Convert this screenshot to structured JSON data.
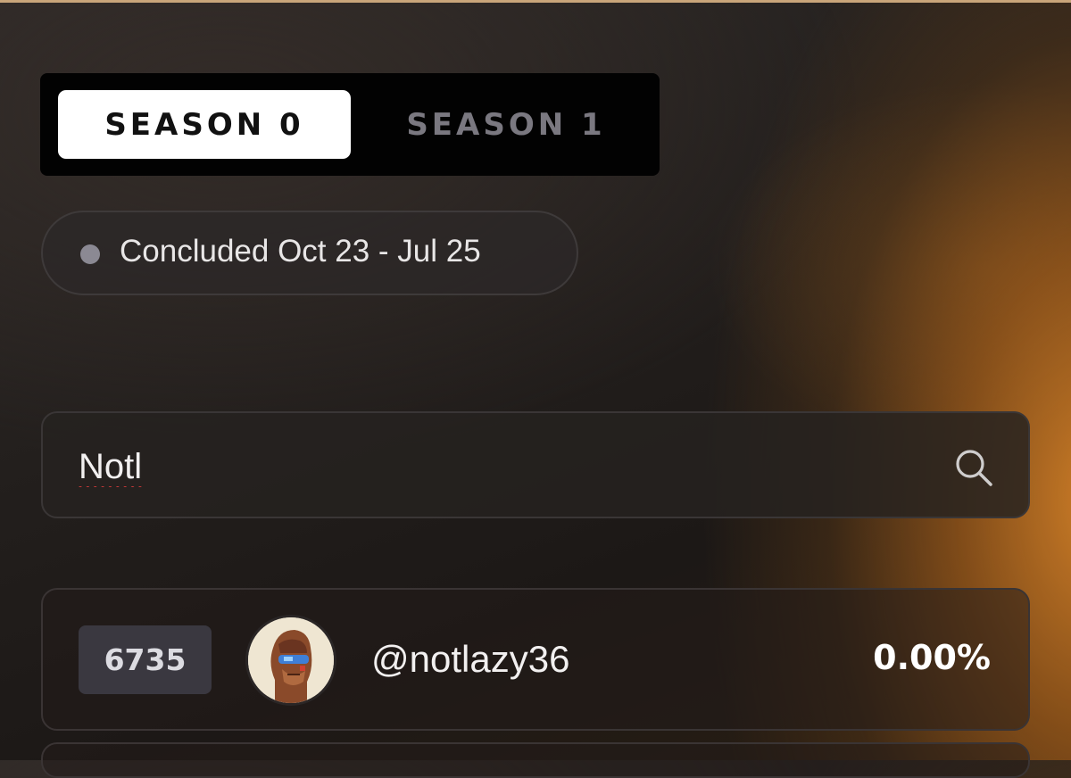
{
  "seasons": {
    "tabs": [
      {
        "label": "SEASON 0",
        "selected": true
      },
      {
        "label": "SEASON 1",
        "selected": false
      }
    ]
  },
  "status": {
    "text": "Concluded Oct 23 - Jul 25",
    "dot_color": "#8b8993"
  },
  "search": {
    "value": "Notl",
    "icon": "search-icon"
  },
  "results": [
    {
      "rank": "6735",
      "username": "@notlazy36",
      "share": "0.00%",
      "avatar": "ape-avatar"
    }
  ],
  "colors": {
    "accent_glow": "#d6822a",
    "selected_tab_bg": "#ffffff",
    "inactive_tab_text": "#7a7880"
  }
}
